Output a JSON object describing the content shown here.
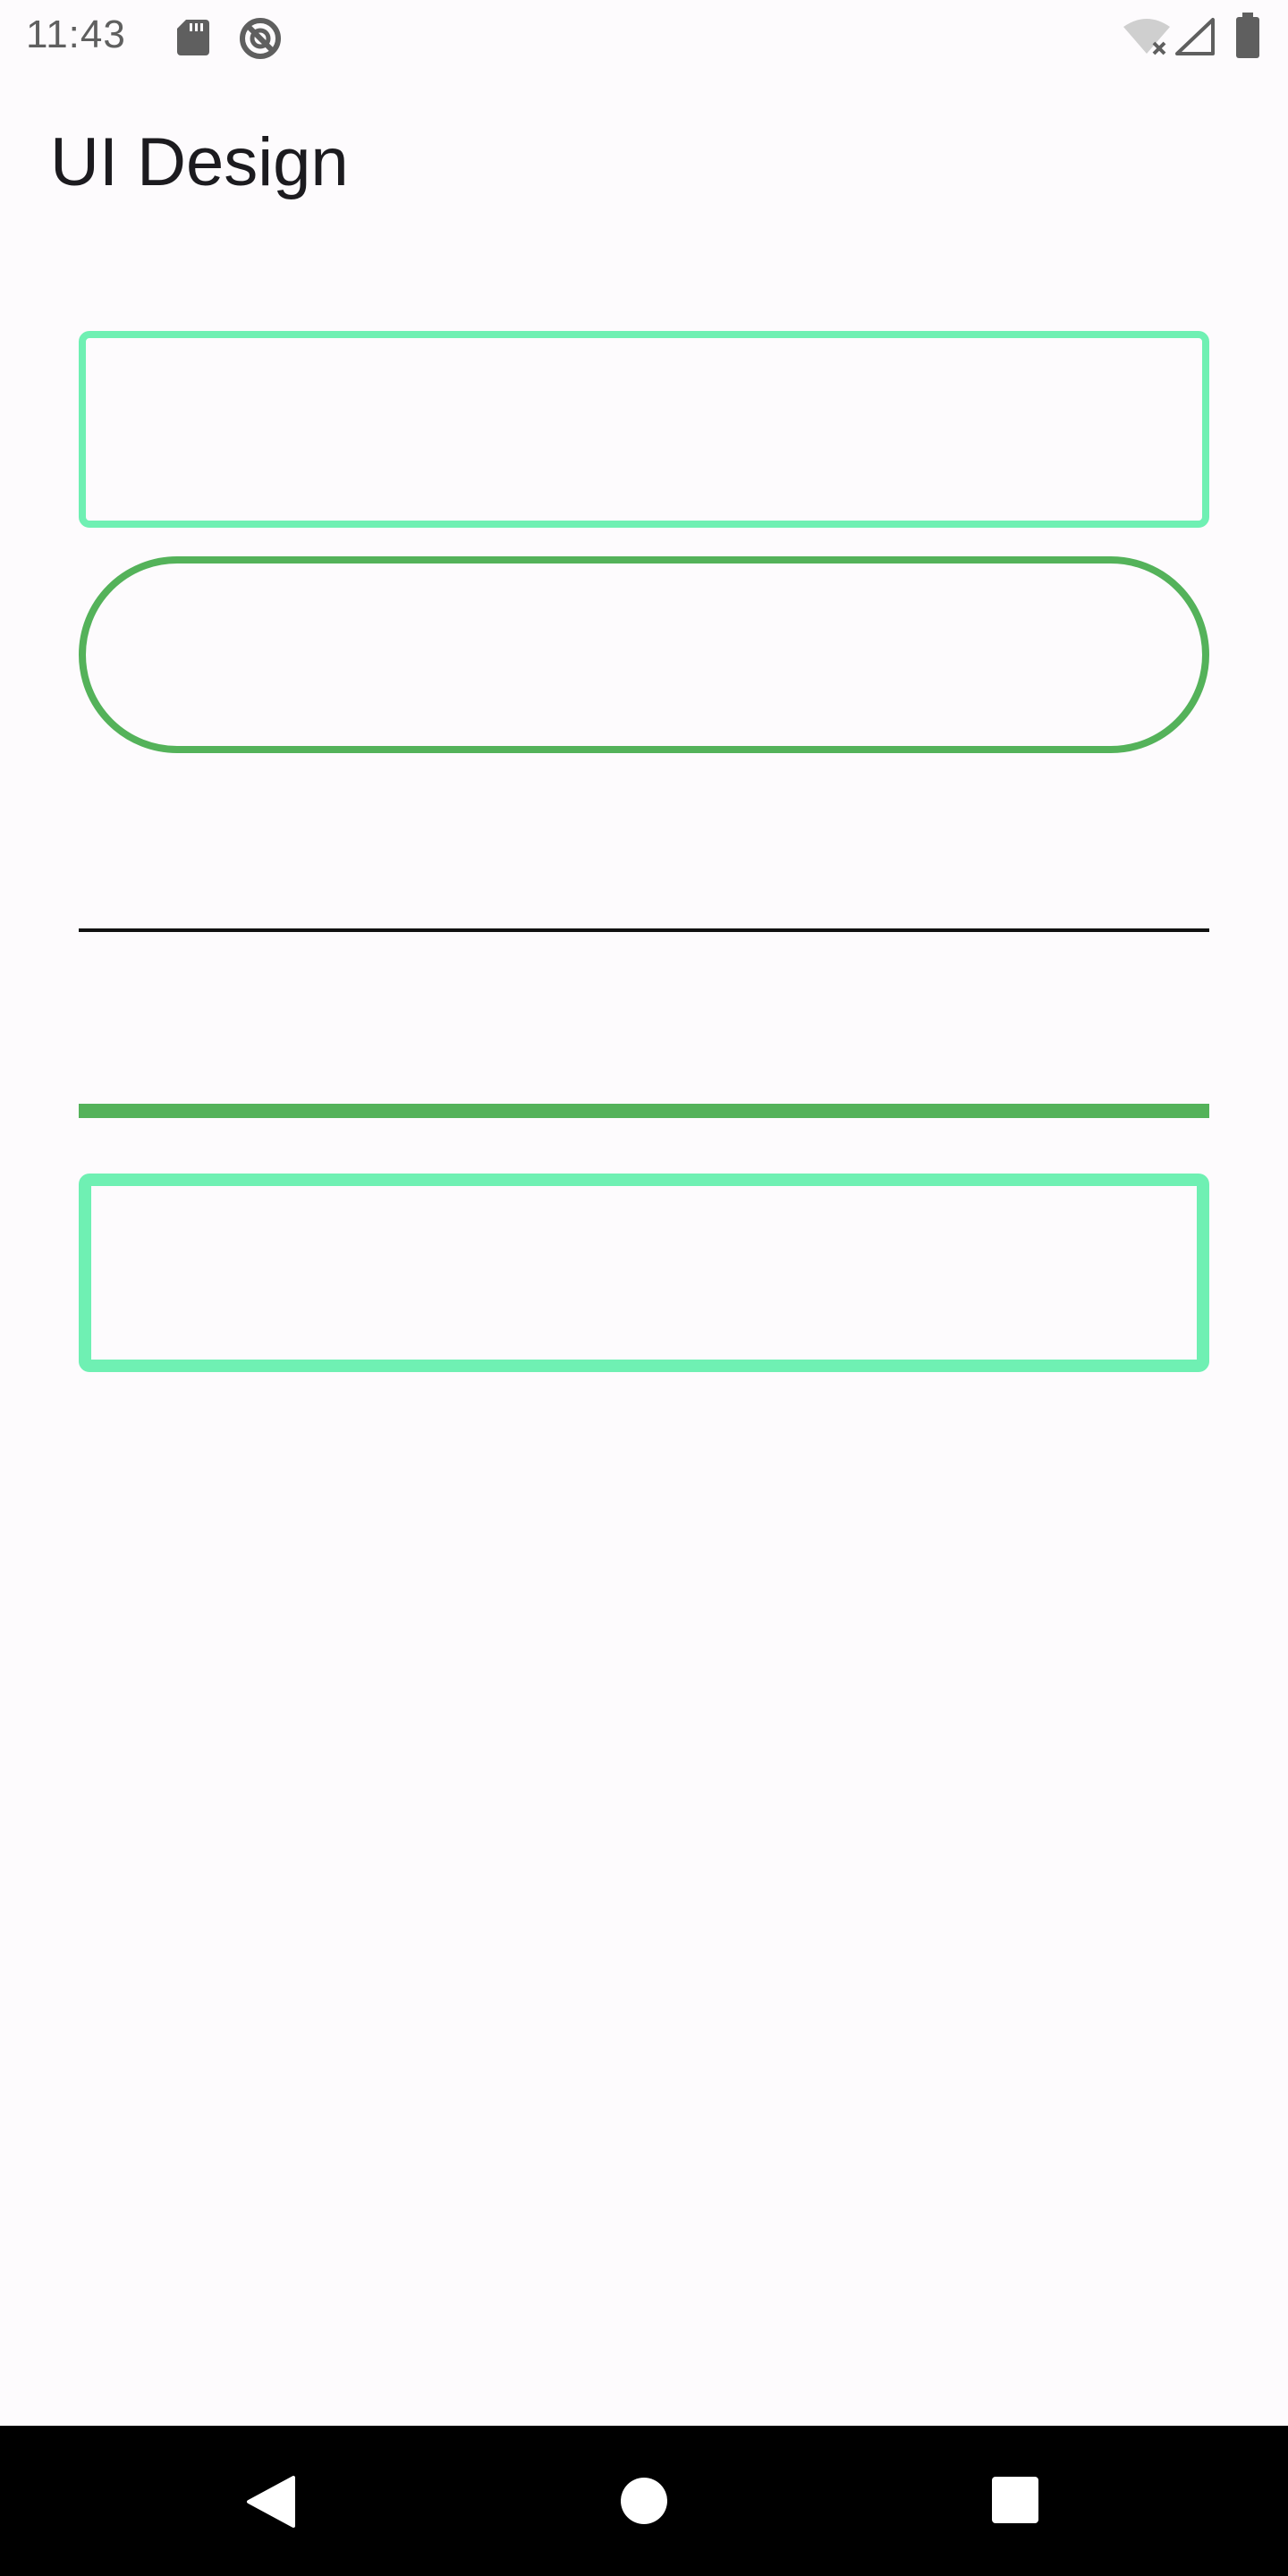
{
  "status_bar": {
    "time": "11:43",
    "icons": [
      "sd-card-icon",
      "do-not-disturb-icon",
      "wifi-off-icon",
      "signal-icon",
      "battery-icon"
    ]
  },
  "app": {
    "title": "UI Design"
  },
  "colors": {
    "background": "#fdfbfd",
    "mint_green": "#6ff0b3",
    "green": "#54b25a",
    "divider": "#111111",
    "nav_bar": "#000000"
  },
  "nav_bar": {
    "buttons": [
      "back-icon",
      "home-icon",
      "recents-icon"
    ]
  }
}
